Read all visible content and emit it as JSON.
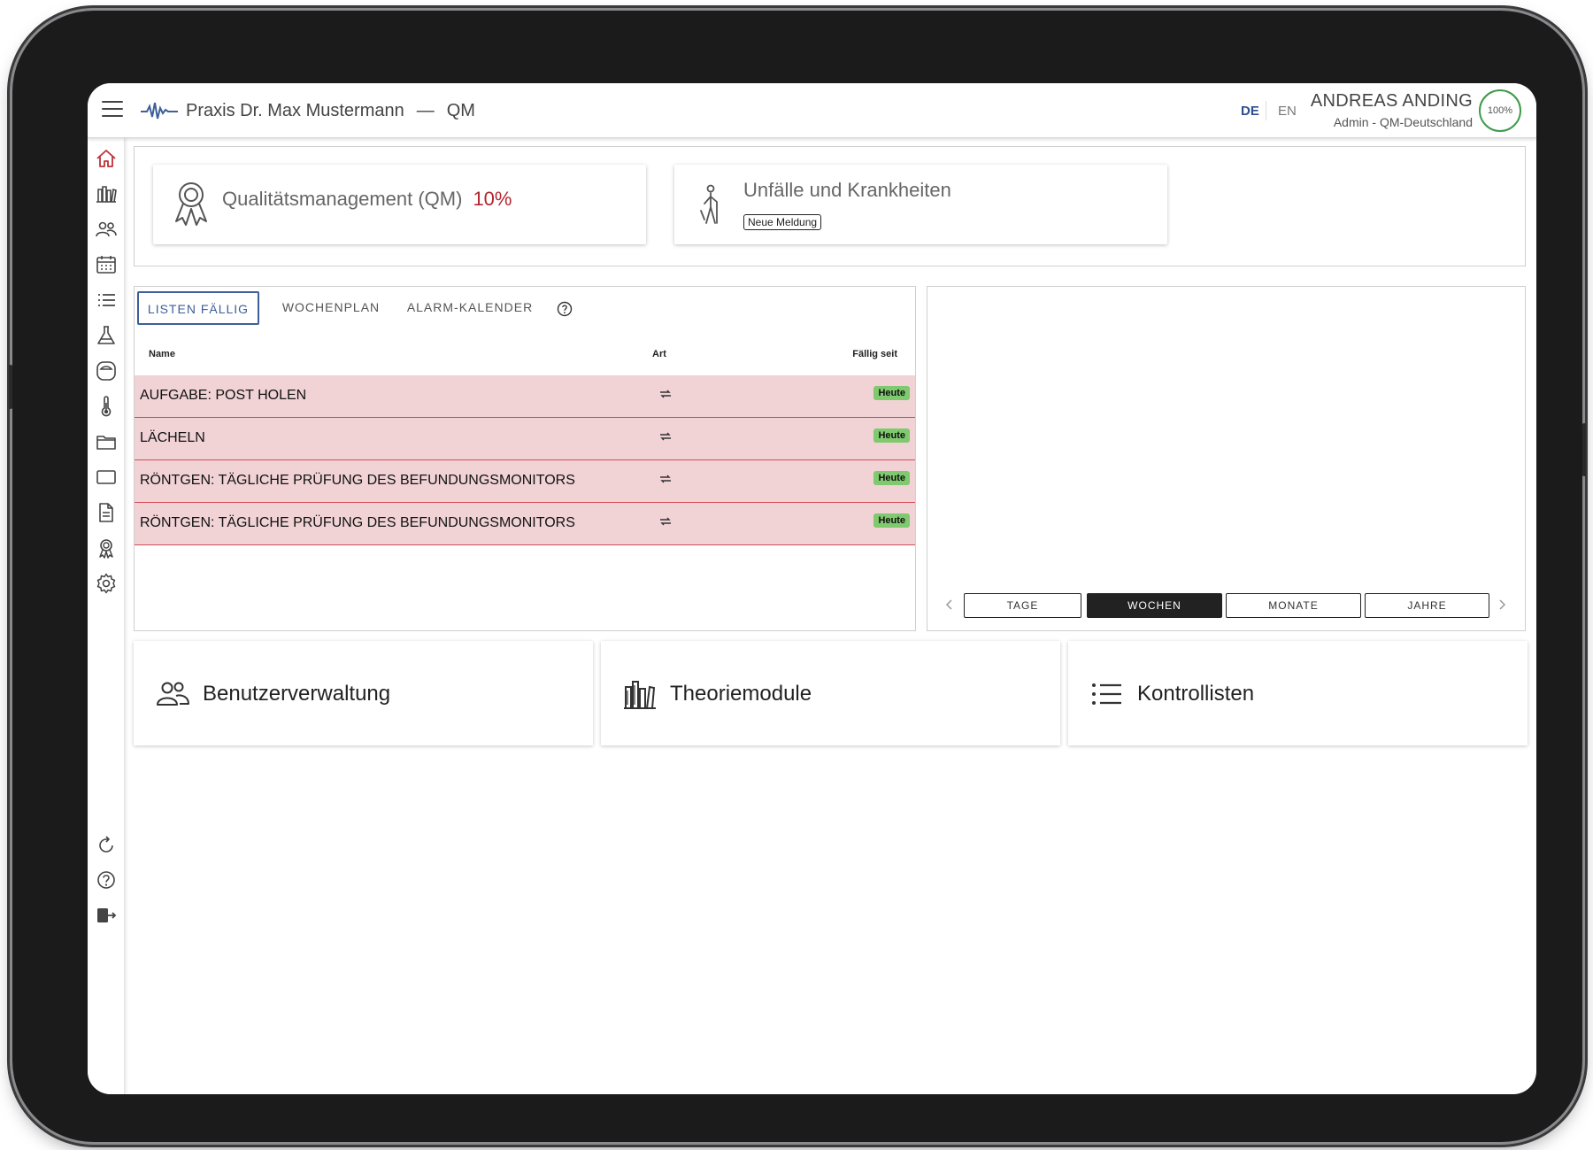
{
  "app": {
    "practice_name": "Praxis Dr. Max Mustermann",
    "separator": "—",
    "module": "QM"
  },
  "header": {
    "lang_de": "DE",
    "lang_en": "EN",
    "user_name": "ANDREAS ANDING",
    "user_role": "Admin - QM-Deutschland",
    "progress_label": "100%",
    "progress_value": 1.0,
    "accent_color": "#3d5f9a"
  },
  "sidebar": {
    "items": [
      {
        "icon": "home-icon"
      },
      {
        "icon": "library-icon"
      },
      {
        "icon": "users-icon"
      },
      {
        "icon": "calendar-icon"
      },
      {
        "icon": "list-icon"
      },
      {
        "icon": "flask-icon"
      },
      {
        "icon": "device-icon"
      },
      {
        "icon": "thermometer-icon"
      },
      {
        "icon": "folder-icon"
      },
      {
        "icon": "rectangle-icon"
      },
      {
        "icon": "document-icon"
      },
      {
        "icon": "award-icon"
      },
      {
        "icon": "settings-icon"
      }
    ],
    "bottom": [
      {
        "icon": "refresh-icon"
      },
      {
        "icon": "help-icon"
      },
      {
        "icon": "logout-icon"
      }
    ]
  },
  "cards": {
    "qm_title": "Qualitätsmanagement (QM)",
    "qm_percent": "10%",
    "accidents_title": "Unfälle und Krankheiten",
    "accidents_button": "Neue Meldung"
  },
  "tasks": {
    "tabs": [
      "LISTEN FÄLLIG",
      "WOCHENPLAN",
      "ALARM-KALENDER"
    ],
    "columns": {
      "name": "Name",
      "type": "Art",
      "due": "Fällig seit"
    },
    "rows": [
      {
        "name": "AUFGABE: POST HOLEN",
        "type_icon": "repeat-icon",
        "due": "Heute"
      },
      {
        "name": "LÄCHELN",
        "type_icon": "repeat-icon",
        "due": "Heute"
      },
      {
        "name": "RÖNTGEN: TÄGLICHE PRÜFUNG DES BEFUNDUNGSMONITORS",
        "type_icon": "repeat-icon",
        "due": "Heute"
      },
      {
        "name": "RÖNTGEN: TÄGLICHE PRÜFUNG DES BEFUNDUNGSMONITORS",
        "type_icon": "repeat-icon",
        "due": "Heute"
      }
    ]
  },
  "period": {
    "options": [
      "TAGE",
      "WOCHEN",
      "MONATE",
      "JAHRE"
    ],
    "selected": "WOCHEN"
  },
  "tiles": [
    {
      "label": "Benutzerverwaltung",
      "icon": "users-icon"
    },
    {
      "label": "Theoriemodule",
      "icon": "library-icon"
    },
    {
      "label": "Kontrollisten",
      "icon": "list-icon"
    }
  ]
}
